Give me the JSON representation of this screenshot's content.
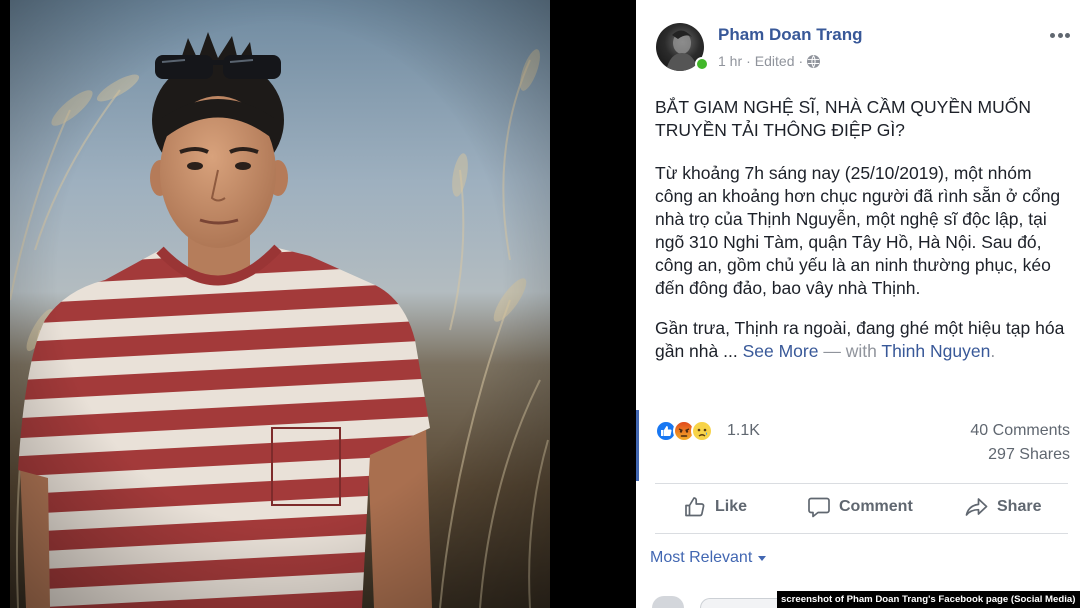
{
  "post": {
    "author": {
      "name": "Pham Doan Trang",
      "online": true,
      "avatar_icon": "profile-avatar"
    },
    "meta": {
      "time": "1 hr",
      "separator": "·",
      "edited": "Edited",
      "privacy_icon": "globe-icon"
    },
    "more_icon": "more-options-icon",
    "paragraphs": [
      {
        "lines": [
          "BẮT GIAM NGHỆ SĨ, NHÀ CẦM QUYỀN MUỐN",
          "TRUYỀN TẢI THÔNG ĐIỆP GÌ?"
        ]
      },
      {
        "lines": [
          "Từ khoảng 7h sáng nay (25/10/2019), một nhóm",
          "công an khoảng hơn chục người đã rình sẵn ở cổng",
          "nhà trọ của Thịnh Nguyễn, một nghệ sĩ độc lập, tại",
          "ngõ 310 Nghi Tàm, quận Tây Hồ, Hà Nội. Sau đó,",
          "công an, gồm chủ yếu là an ninh thường phục, kéo",
          "đến đông đảo, bao vây nhà Thịnh."
        ]
      },
      {
        "lines": [
          "Gần trưa, Thịnh ra ngoài, đang ghé một hiệu tạp hóa"
        ],
        "last_line": {
          "text": "gần nhà ...",
          "see_more": "See More",
          "with_prefix": "— with",
          "tagged": "Thinh Nguyen",
          "end": "."
        }
      }
    ]
  },
  "reactions": {
    "icons": [
      "like-icon",
      "angry-icon",
      "sad-icon"
    ],
    "count": "1.1K",
    "comments": "40 Comments",
    "shares": "297 Shares"
  },
  "actions": [
    {
      "label": "Like",
      "icon": "thumbs-up-icon"
    },
    {
      "label": "Comment",
      "icon": "comment-icon"
    },
    {
      "label": "Share",
      "icon": "share-icon"
    }
  ],
  "comments_section": {
    "sort_label": "Most Relevant",
    "sort_icon": "caret-down-icon"
  },
  "caption": "screenshot of Pham Doan Trang's Facebook page (Social Media)",
  "colors": {
    "name_blue": "#385898",
    "link_blue": "#4267b2",
    "text": "#1d2129",
    "meta_gray": "#90949c",
    "action_gray": "#606770",
    "online_green": "#42b72a",
    "like_blue": "#1877f2"
  }
}
